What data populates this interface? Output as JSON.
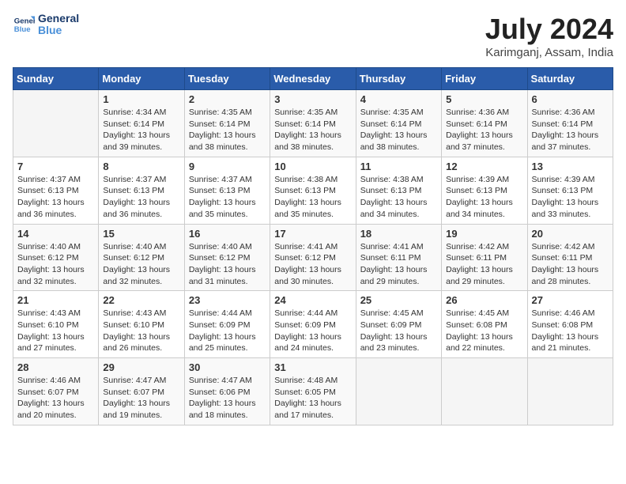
{
  "header": {
    "logo_line1": "General",
    "logo_line2": "Blue",
    "month_title": "July 2024",
    "location": "Karimganj, Assam, India"
  },
  "days_of_week": [
    "Sunday",
    "Monday",
    "Tuesday",
    "Wednesday",
    "Thursday",
    "Friday",
    "Saturday"
  ],
  "weeks": [
    [
      {
        "day": "",
        "info": ""
      },
      {
        "day": "1",
        "info": "Sunrise: 4:34 AM\nSunset: 6:14 PM\nDaylight: 13 hours\nand 39 minutes."
      },
      {
        "day": "2",
        "info": "Sunrise: 4:35 AM\nSunset: 6:14 PM\nDaylight: 13 hours\nand 38 minutes."
      },
      {
        "day": "3",
        "info": "Sunrise: 4:35 AM\nSunset: 6:14 PM\nDaylight: 13 hours\nand 38 minutes."
      },
      {
        "day": "4",
        "info": "Sunrise: 4:35 AM\nSunset: 6:14 PM\nDaylight: 13 hours\nand 38 minutes."
      },
      {
        "day": "5",
        "info": "Sunrise: 4:36 AM\nSunset: 6:14 PM\nDaylight: 13 hours\nand 37 minutes."
      },
      {
        "day": "6",
        "info": "Sunrise: 4:36 AM\nSunset: 6:14 PM\nDaylight: 13 hours\nand 37 minutes."
      }
    ],
    [
      {
        "day": "7",
        "info": "Sunrise: 4:37 AM\nSunset: 6:13 PM\nDaylight: 13 hours\nand 36 minutes."
      },
      {
        "day": "8",
        "info": "Sunrise: 4:37 AM\nSunset: 6:13 PM\nDaylight: 13 hours\nand 36 minutes."
      },
      {
        "day": "9",
        "info": "Sunrise: 4:37 AM\nSunset: 6:13 PM\nDaylight: 13 hours\nand 35 minutes."
      },
      {
        "day": "10",
        "info": "Sunrise: 4:38 AM\nSunset: 6:13 PM\nDaylight: 13 hours\nand 35 minutes."
      },
      {
        "day": "11",
        "info": "Sunrise: 4:38 AM\nSunset: 6:13 PM\nDaylight: 13 hours\nand 34 minutes."
      },
      {
        "day": "12",
        "info": "Sunrise: 4:39 AM\nSunset: 6:13 PM\nDaylight: 13 hours\nand 34 minutes."
      },
      {
        "day": "13",
        "info": "Sunrise: 4:39 AM\nSunset: 6:13 PM\nDaylight: 13 hours\nand 33 minutes."
      }
    ],
    [
      {
        "day": "14",
        "info": "Sunrise: 4:40 AM\nSunset: 6:12 PM\nDaylight: 13 hours\nand 32 minutes."
      },
      {
        "day": "15",
        "info": "Sunrise: 4:40 AM\nSunset: 6:12 PM\nDaylight: 13 hours\nand 32 minutes."
      },
      {
        "day": "16",
        "info": "Sunrise: 4:40 AM\nSunset: 6:12 PM\nDaylight: 13 hours\nand 31 minutes."
      },
      {
        "day": "17",
        "info": "Sunrise: 4:41 AM\nSunset: 6:12 PM\nDaylight: 13 hours\nand 30 minutes."
      },
      {
        "day": "18",
        "info": "Sunrise: 4:41 AM\nSunset: 6:11 PM\nDaylight: 13 hours\nand 29 minutes."
      },
      {
        "day": "19",
        "info": "Sunrise: 4:42 AM\nSunset: 6:11 PM\nDaylight: 13 hours\nand 29 minutes."
      },
      {
        "day": "20",
        "info": "Sunrise: 4:42 AM\nSunset: 6:11 PM\nDaylight: 13 hours\nand 28 minutes."
      }
    ],
    [
      {
        "day": "21",
        "info": "Sunrise: 4:43 AM\nSunset: 6:10 PM\nDaylight: 13 hours\nand 27 minutes."
      },
      {
        "day": "22",
        "info": "Sunrise: 4:43 AM\nSunset: 6:10 PM\nDaylight: 13 hours\nand 26 minutes."
      },
      {
        "day": "23",
        "info": "Sunrise: 4:44 AM\nSunset: 6:09 PM\nDaylight: 13 hours\nand 25 minutes."
      },
      {
        "day": "24",
        "info": "Sunrise: 4:44 AM\nSunset: 6:09 PM\nDaylight: 13 hours\nand 24 minutes."
      },
      {
        "day": "25",
        "info": "Sunrise: 4:45 AM\nSunset: 6:09 PM\nDaylight: 13 hours\nand 23 minutes."
      },
      {
        "day": "26",
        "info": "Sunrise: 4:45 AM\nSunset: 6:08 PM\nDaylight: 13 hours\nand 22 minutes."
      },
      {
        "day": "27",
        "info": "Sunrise: 4:46 AM\nSunset: 6:08 PM\nDaylight: 13 hours\nand 21 minutes."
      }
    ],
    [
      {
        "day": "28",
        "info": "Sunrise: 4:46 AM\nSunset: 6:07 PM\nDaylight: 13 hours\nand 20 minutes."
      },
      {
        "day": "29",
        "info": "Sunrise: 4:47 AM\nSunset: 6:07 PM\nDaylight: 13 hours\nand 19 minutes."
      },
      {
        "day": "30",
        "info": "Sunrise: 4:47 AM\nSunset: 6:06 PM\nDaylight: 13 hours\nand 18 minutes."
      },
      {
        "day": "31",
        "info": "Sunrise: 4:48 AM\nSunset: 6:05 PM\nDaylight: 13 hours\nand 17 minutes."
      },
      {
        "day": "",
        "info": ""
      },
      {
        "day": "",
        "info": ""
      },
      {
        "day": "",
        "info": ""
      }
    ]
  ]
}
